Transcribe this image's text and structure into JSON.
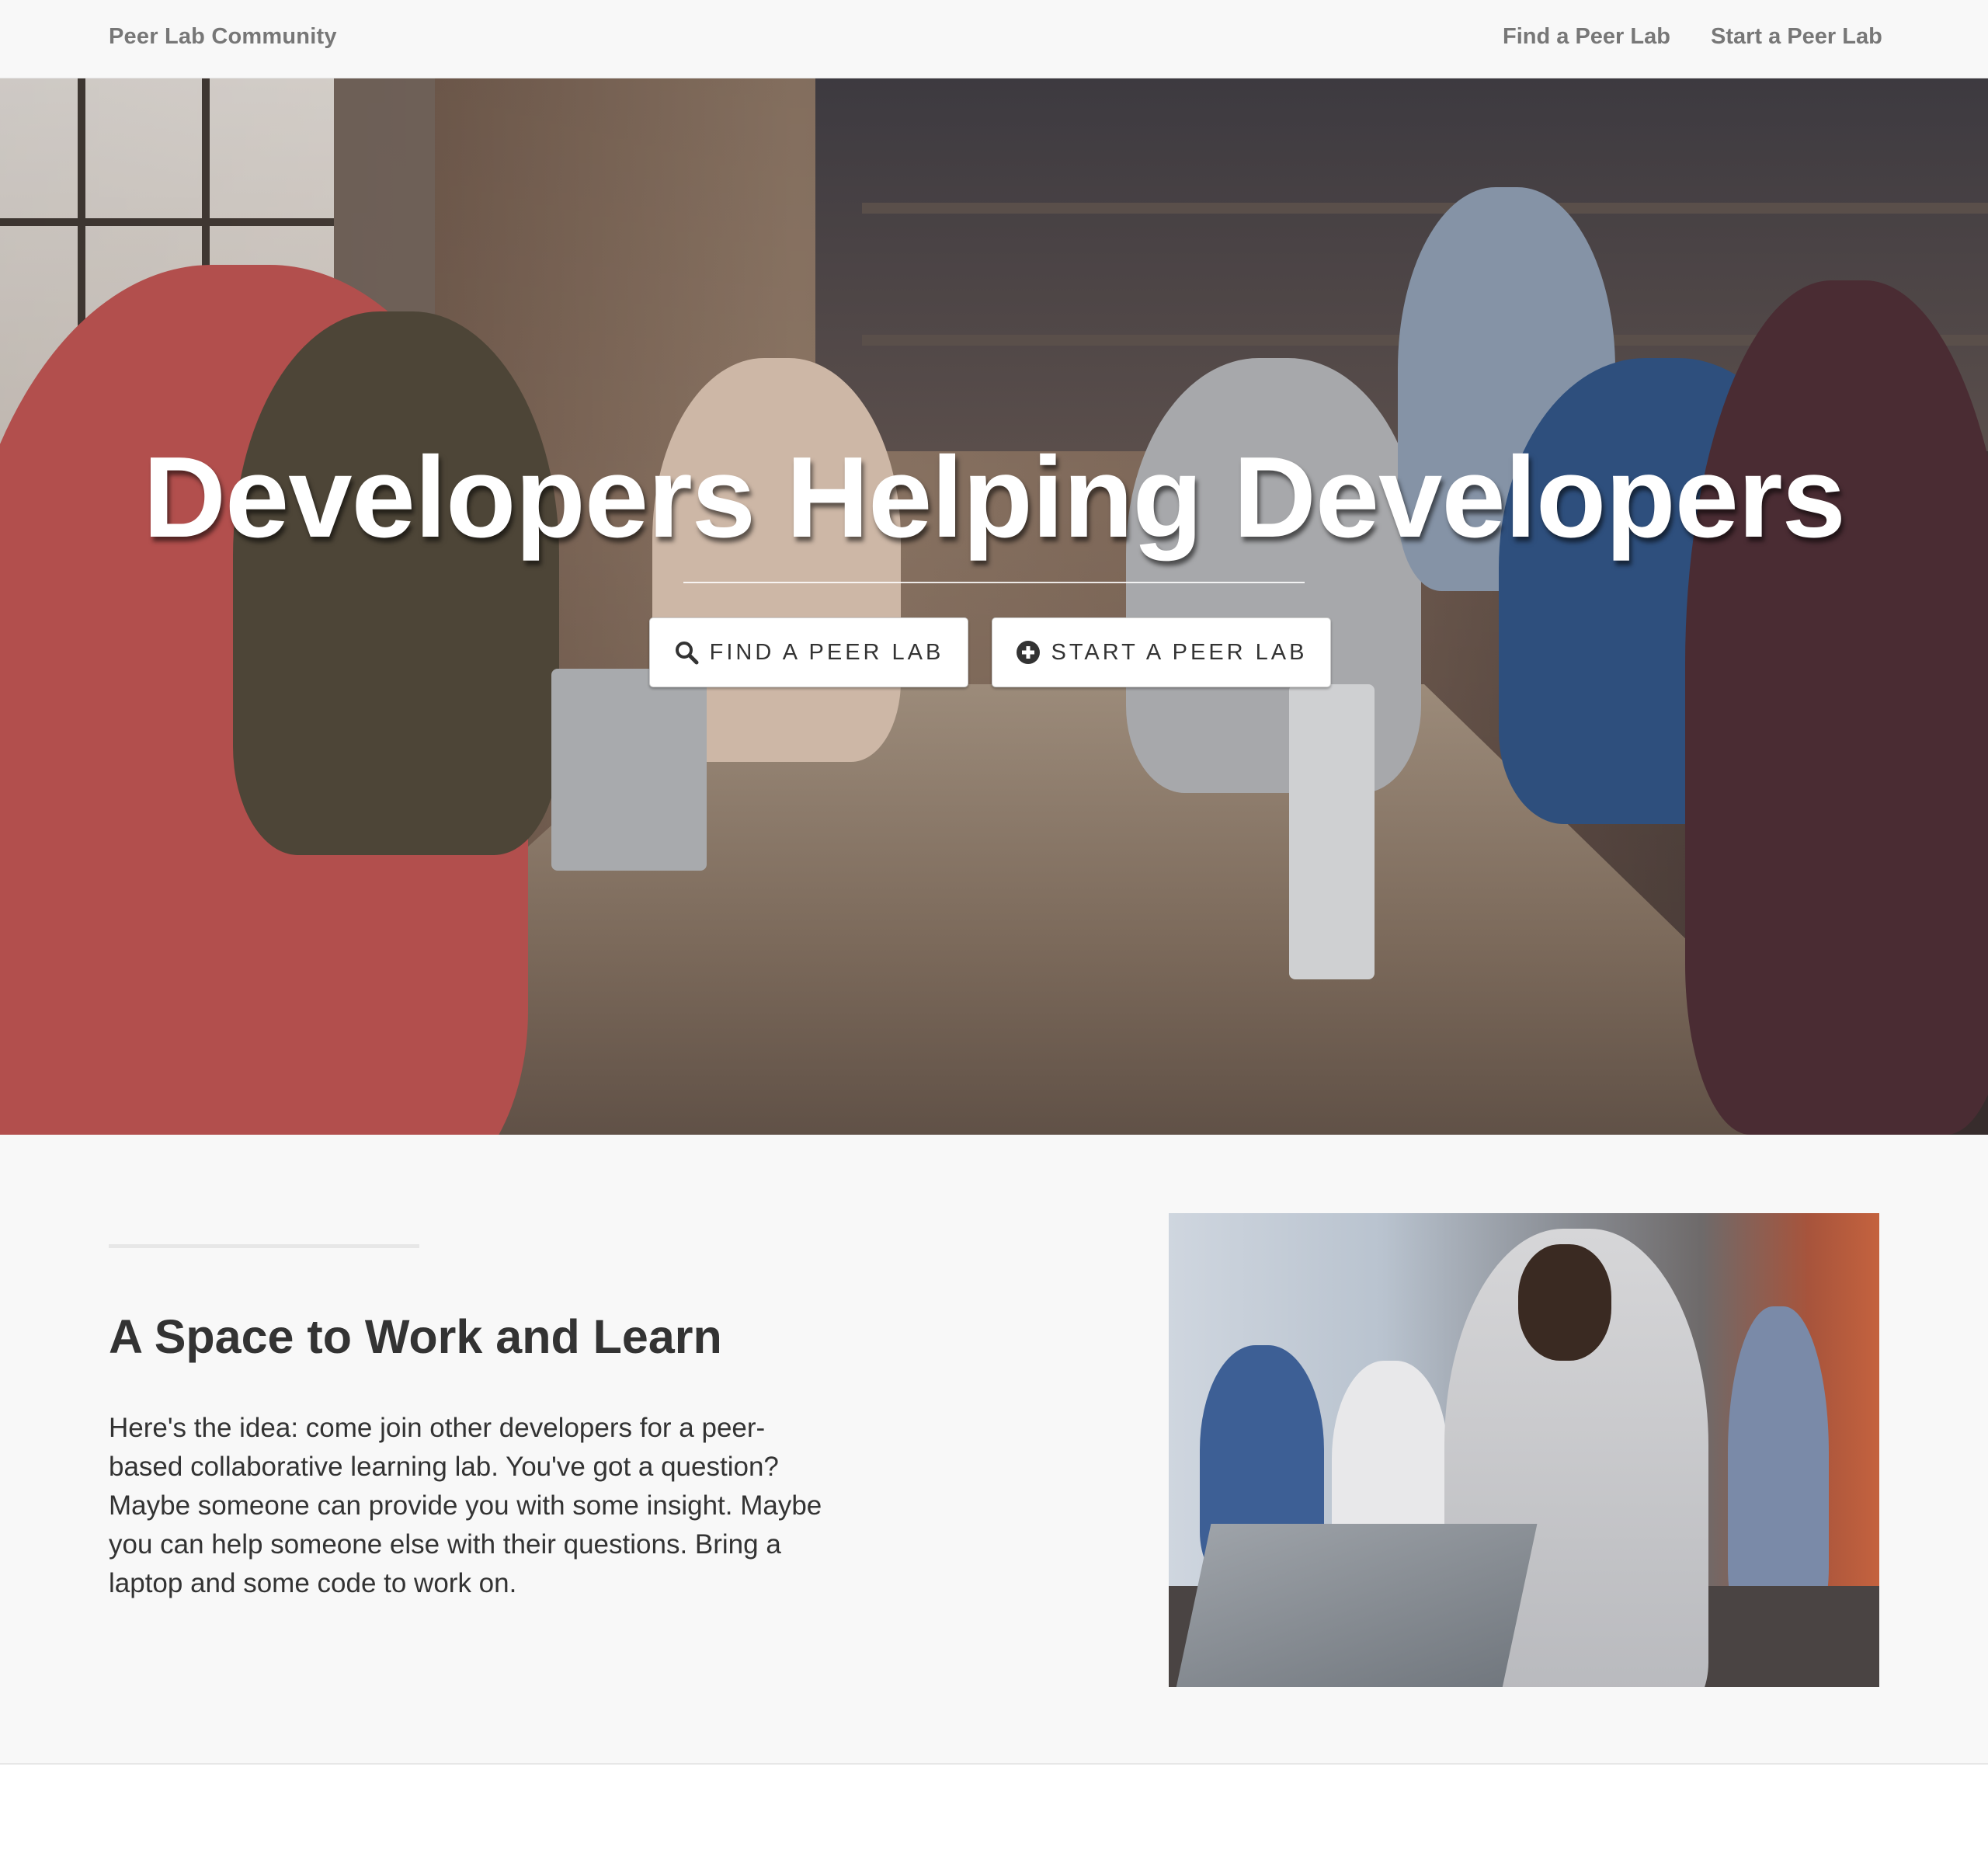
{
  "navbar": {
    "brand": "Peer Lab Community",
    "links": [
      {
        "label": "Find a Peer Lab"
      },
      {
        "label": "Start a Peer Lab"
      }
    ]
  },
  "hero": {
    "heading": "Developers Helping Developers",
    "buttons": {
      "find": {
        "label": "FIND A PEER LAB",
        "icon": "search-icon"
      },
      "start": {
        "label": "START A PEER LAB",
        "icon": "plus-circle-icon"
      }
    }
  },
  "intro": {
    "title": "A Space to Work and Learn",
    "body": "Here's the idea: come join other developers for a peer-based collaborative learning lab. You've got a question? Maybe someone can provide you with some insight. Maybe you can help someone else with their questions. Bring a laptop and some code to work on."
  },
  "colors": {
    "navbar_bg": "#f8f8f8",
    "nav_text": "#777777",
    "body_text": "#333333",
    "hero_text": "#ffffff"
  }
}
